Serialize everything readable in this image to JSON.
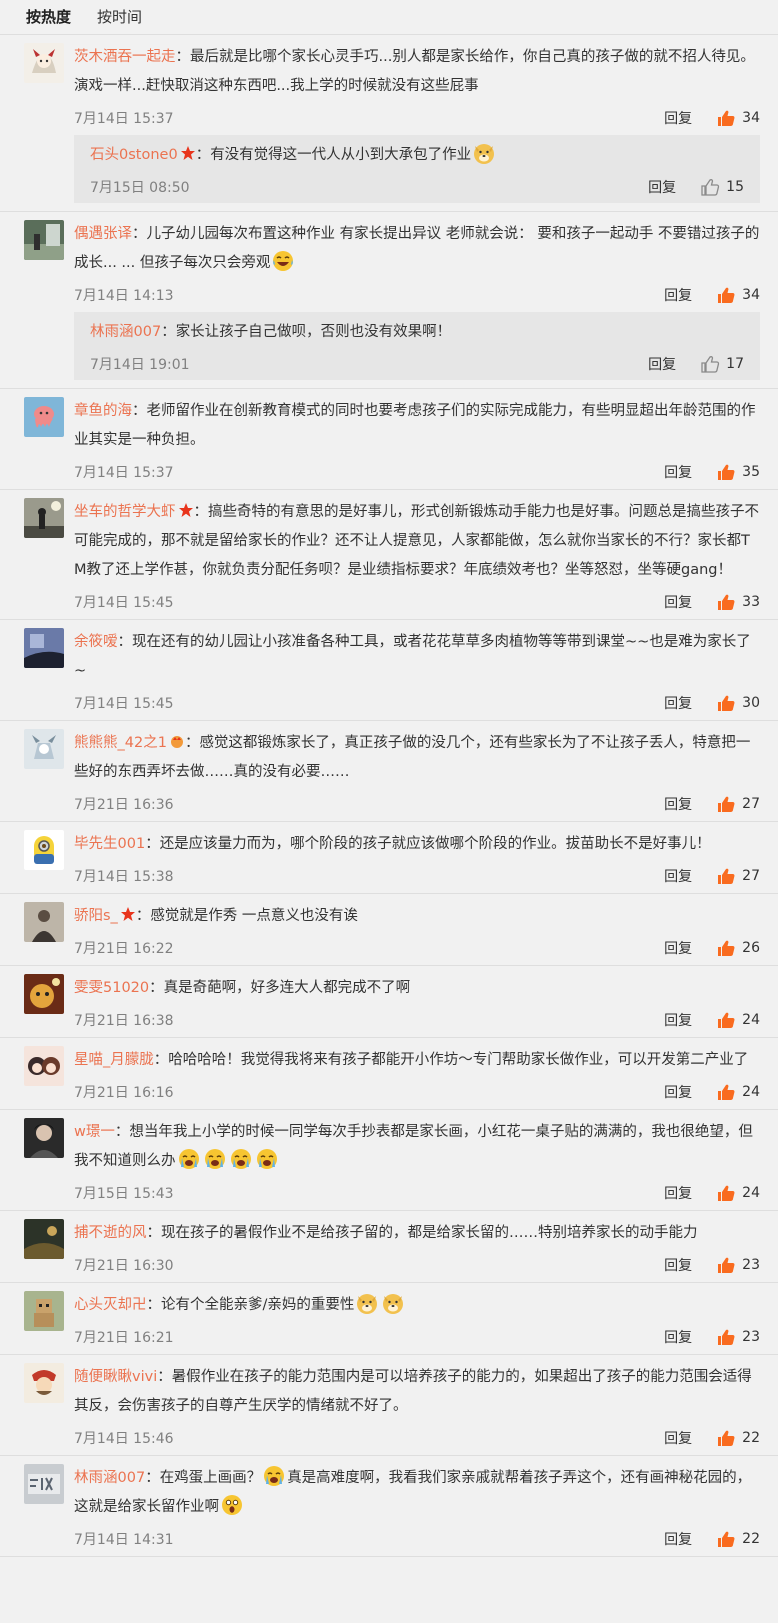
{
  "sort": {
    "hot": "按热度",
    "time": "按时间"
  },
  "labels": {
    "reply": "回复",
    "sep": "："
  },
  "colors": {
    "username": "#eb7350",
    "like_active": "#f96b1f",
    "subreply_bg": "#e6e6e6"
  },
  "comments": [
    {
      "user": "茨木酒吞一起走",
      "text": "最后就是比哪个家长心灵手巧...别人都是家长给作，你自己真的孩子做的就不招人待见。演戏一样...赶快取消这种东西吧...我上学的时候就没有这些屁事",
      "time": "7月14日 15:37",
      "likes": "34",
      "reply": {
        "user": "石头0stone0",
        "text": "有没有觉得这一代人从小到大承包了作业",
        "time": "7月15日 08:50",
        "likes": "15"
      }
    },
    {
      "user": "偶遇张译",
      "text": "儿子幼儿园每次布置这种作业 有家长提出异议 老师就会说： 要和孩子一起动手 不要错过孩子的成长... ... 但孩子每次只会旁观",
      "time": "7月14日 14:13",
      "likes": "34",
      "reply": {
        "user": "林雨涵007",
        "text": "家长让孩子自己做呗，否则也没有效果啊！",
        "time": "7月14日 19:01",
        "likes": "17"
      }
    },
    {
      "user": "章鱼的海",
      "text": "老师留作业在创新教育模式的同时也要考虑孩子们的实际完成能力，有些明显超出年龄范围的作业其实是一种负担。",
      "time": "7月14日 15:37",
      "likes": "35"
    },
    {
      "user": "坐车的哲学大虾",
      "text": "搞些奇特的有意思的是好事儿，形式创新锻炼动手能力也是好事。问题总是搞些孩子不可能完成的，那不就是留给家长的作业？还不让人提意见，人家都能做，怎么就你当家长的不行？家长都TM教了还上学作甚，你就负责分配任务呗？是业绩指标要求？年底绩效考也？坐等怒怼，坐等硬gang！",
      "time": "7月14日 15:45",
      "likes": "33"
    },
    {
      "user": "余筱嗳",
      "text": "现在还有的幼儿园让小孩准备各种工具，或者花花草草多肉植物等等带到课堂~~也是难为家长了~",
      "time": "7月14日 15:45",
      "likes": "30"
    },
    {
      "user": "熊熊熊_42之1",
      "text": "感觉这都锻炼家长了，真正孩子做的没几个，还有些家长为了不让孩子丢人，特意把一些好的东西弄坏去做……真的没有必要……",
      "time": "7月21日 16:36",
      "likes": "27"
    },
    {
      "user": "毕先生001",
      "text": "还是应该量力而为，哪个阶段的孩子就应该做哪个阶段的作业。拔苗助长不是好事儿！",
      "time": "7月14日 15:38",
      "likes": "27"
    },
    {
      "user": "骄阳s_",
      "text": "感觉就是作秀 一点意义也没有诶",
      "time": "7月21日 16:22",
      "likes": "26"
    },
    {
      "user": "雯雯51020",
      "text": "真是奇葩啊，好多连大人都完成不了啊",
      "time": "7月21日 16:38",
      "likes": "24"
    },
    {
      "user": "星喵_月朦胧",
      "text": "哈哈哈哈！我觉得我将来有孩子都能开小作坊～专门帮助家长做作业，可以开发第二产业了",
      "time": "7月21日 16:16",
      "likes": "24"
    },
    {
      "user": "w璟一",
      "text": "想当年我上小学的时候一同学每次手抄表都是家长画，小红花一桌子贴的满满的，我也很绝望，但我不知道则么办",
      "time": "7月15日 15:43",
      "likes": "24"
    },
    {
      "user": "捕不逝的风",
      "text": "现在孩子的暑假作业不是给孩子留的，都是给家长留的……特别培养家长的动手能力",
      "time": "7月21日 16:30",
      "likes": "23"
    },
    {
      "user": "心头灭却卍",
      "text": "论有个全能亲爹/亲妈的重要性",
      "time": "7月21日 16:21",
      "likes": "23"
    },
    {
      "user": "随便瞅瞅vivi",
      "text": "暑假作业在孩子的能力范围内是可以培养孩子的能力的，如果超出了孩子的能力范围会适得其反，会伤害孩子的自尊产生厌学的情绪就不好了。",
      "time": "7月14日 15:46",
      "likes": "22"
    },
    {
      "user": "林雨涵007",
      "text": "在鸡蛋上画画？",
      "text2": "真是高难度啊，我看我们家亲戚就帮着孩子弄这个，还有画神秘花园的，这就是给家长留作业啊",
      "time": "7月14日 14:31",
      "likes": "22"
    }
  ]
}
